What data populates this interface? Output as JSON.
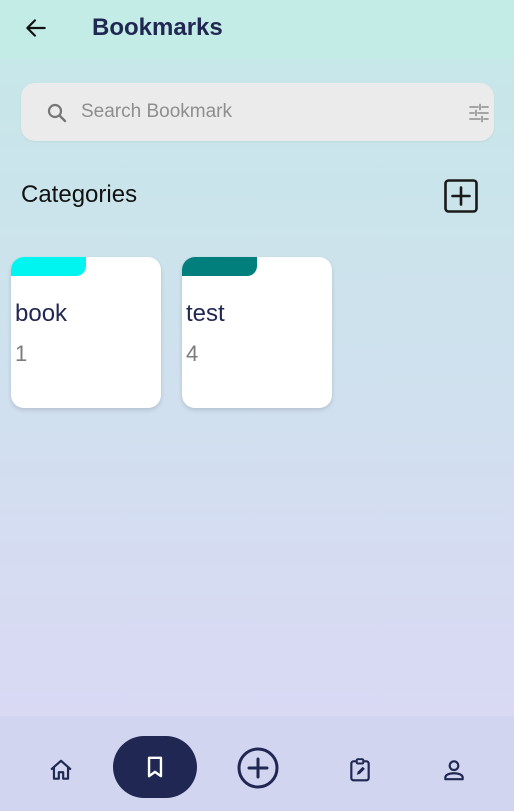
{
  "header": {
    "title": "Bookmarks",
    "back_icon": "arrow-left-icon"
  },
  "search": {
    "placeholder": "Search Bookmark",
    "value": "",
    "icon": "search-icon",
    "filter_icon": "tune-icon"
  },
  "categories": {
    "title": "Categories",
    "add_icon": "add-box-icon",
    "items": [
      {
        "name": "book",
        "count": "1",
        "color": "#00f5f0"
      },
      {
        "name": "test",
        "count": "4",
        "color": "#007f7c"
      }
    ]
  },
  "bottom_nav": {
    "items": [
      {
        "name": "home",
        "icon": "home-icon",
        "active": false
      },
      {
        "name": "bookmarks",
        "icon": "bookmark-icon",
        "active": true
      },
      {
        "name": "add",
        "icon": "add-circle-icon",
        "active": false
      },
      {
        "name": "tasks",
        "icon": "clipboard-edit-icon",
        "active": false
      },
      {
        "name": "profile",
        "icon": "person-icon",
        "active": false
      }
    ]
  },
  "colors": {
    "primary": "#1f2752",
    "header_bg": "#c4ece6",
    "nav_bg": "#d1d5ef",
    "search_bg": "#ebebeb"
  }
}
